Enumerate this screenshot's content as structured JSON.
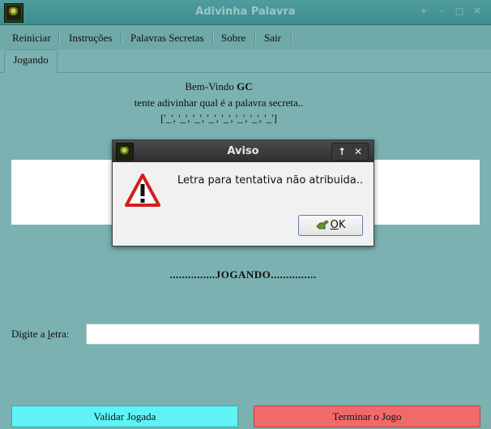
{
  "window": {
    "title": "Adivinha Palavra"
  },
  "menu": [
    "Reiniciar",
    "Instruções",
    "Palavras Secretas",
    "Sobre",
    "Sair"
  ],
  "tab": "Jogando",
  "welcome": {
    "prefix": "Bem-Vindo ",
    "name": "GC"
  },
  "instruction": "tente adivinhar qual é a palavra secreta..",
  "pattern": "['_', '_', '_', '_', '_', '_', '_', '_']",
  "status": "...............JOGANDO...............",
  "letter_field": {
    "label_before": "Digite a ",
    "label_mnemonic": "l",
    "label_after": "etra:",
    "value": ""
  },
  "buttons": {
    "validar": "Validar Jogada",
    "terminar": "Terminar o Jogo"
  },
  "dialog": {
    "title": "Aviso",
    "message": "Letra para tentativa não atribuida..",
    "ok_mnemonic": "O",
    "ok_rest": "K"
  },
  "colors": {
    "background": "#7bb1b1",
    "validar": "#5ff3f6",
    "terminar": "#f16a6a",
    "warning": "#d21f1f"
  }
}
